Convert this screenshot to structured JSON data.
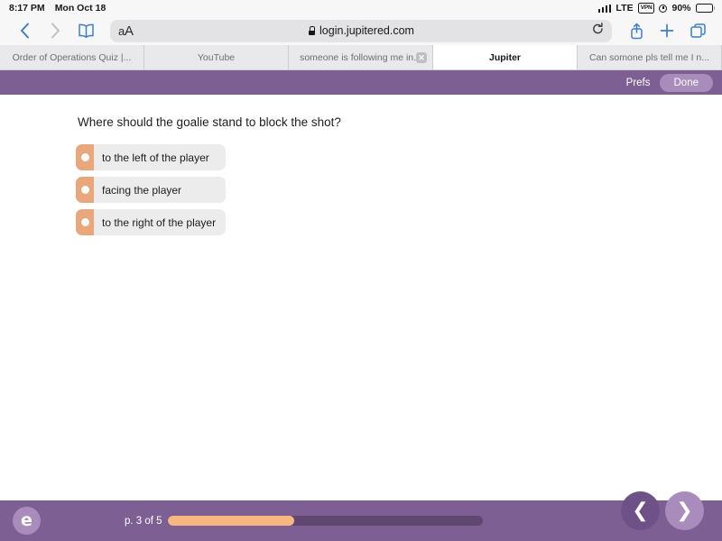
{
  "status_bar": {
    "time": "8:17 PM",
    "date": "Mon Oct 18",
    "network": "LTE",
    "vpn_badge": "VPN",
    "battery_percent": "90%",
    "icons": [
      "signal-bars-icon",
      "vpn-badge-icon",
      "alarm-clock-icon",
      "battery-icon"
    ]
  },
  "browser": {
    "back_icon": "chevron-left-icon",
    "forward_icon": "chevron-right-icon",
    "bookmarks_icon": "book-icon",
    "text_size_label_small": "a",
    "text_size_label_large": "A",
    "url": "login.jupitered.com",
    "lock_icon": "lock-icon",
    "reload_icon": "reload-icon",
    "share_icon": "share-icon",
    "new_tab_icon": "plus-icon",
    "tabs_overview_icon": "tabs-icon",
    "tabs": [
      {
        "title": "Order of Operations Quiz |...",
        "active": false,
        "closable": false
      },
      {
        "title": "YouTube",
        "active": false,
        "closable": false
      },
      {
        "title": "someone is following me in...",
        "active": false,
        "closable": true,
        "close_label": "✕"
      },
      {
        "title": "Jupiter",
        "active": true,
        "closable": false
      },
      {
        "title": "Can somone pls tell me I n...",
        "active": false,
        "closable": false
      }
    ]
  },
  "jupiter_header": {
    "prefs_label": "Prefs",
    "done_label": "Done"
  },
  "quiz": {
    "question": "Where should the goalie stand to block the shot?",
    "choices": [
      {
        "label": "to the left of the player",
        "selected": false
      },
      {
        "label": "facing the player",
        "selected": false
      },
      {
        "label": "to the right of the player",
        "selected": false
      }
    ]
  },
  "footer": {
    "logo_glyph": "e",
    "logo_name": "jupiter-logo",
    "page_label": "p. 3 of 5",
    "progress_percent": 40,
    "prev_icon": "chevron-left-icon",
    "next_icon": "chevron-right-icon",
    "prev_glyph": "❮",
    "next_glyph": "❯"
  },
  "colors": {
    "jupiter_purple": "#7d5f93",
    "jupiter_purple_light": "#a98cbb",
    "jupiter_purple_dark": "#5f4771",
    "accent_orange": "#e8a87c",
    "progress_orange": "#f5b97f",
    "safari_blue": "#3b7fcc"
  }
}
